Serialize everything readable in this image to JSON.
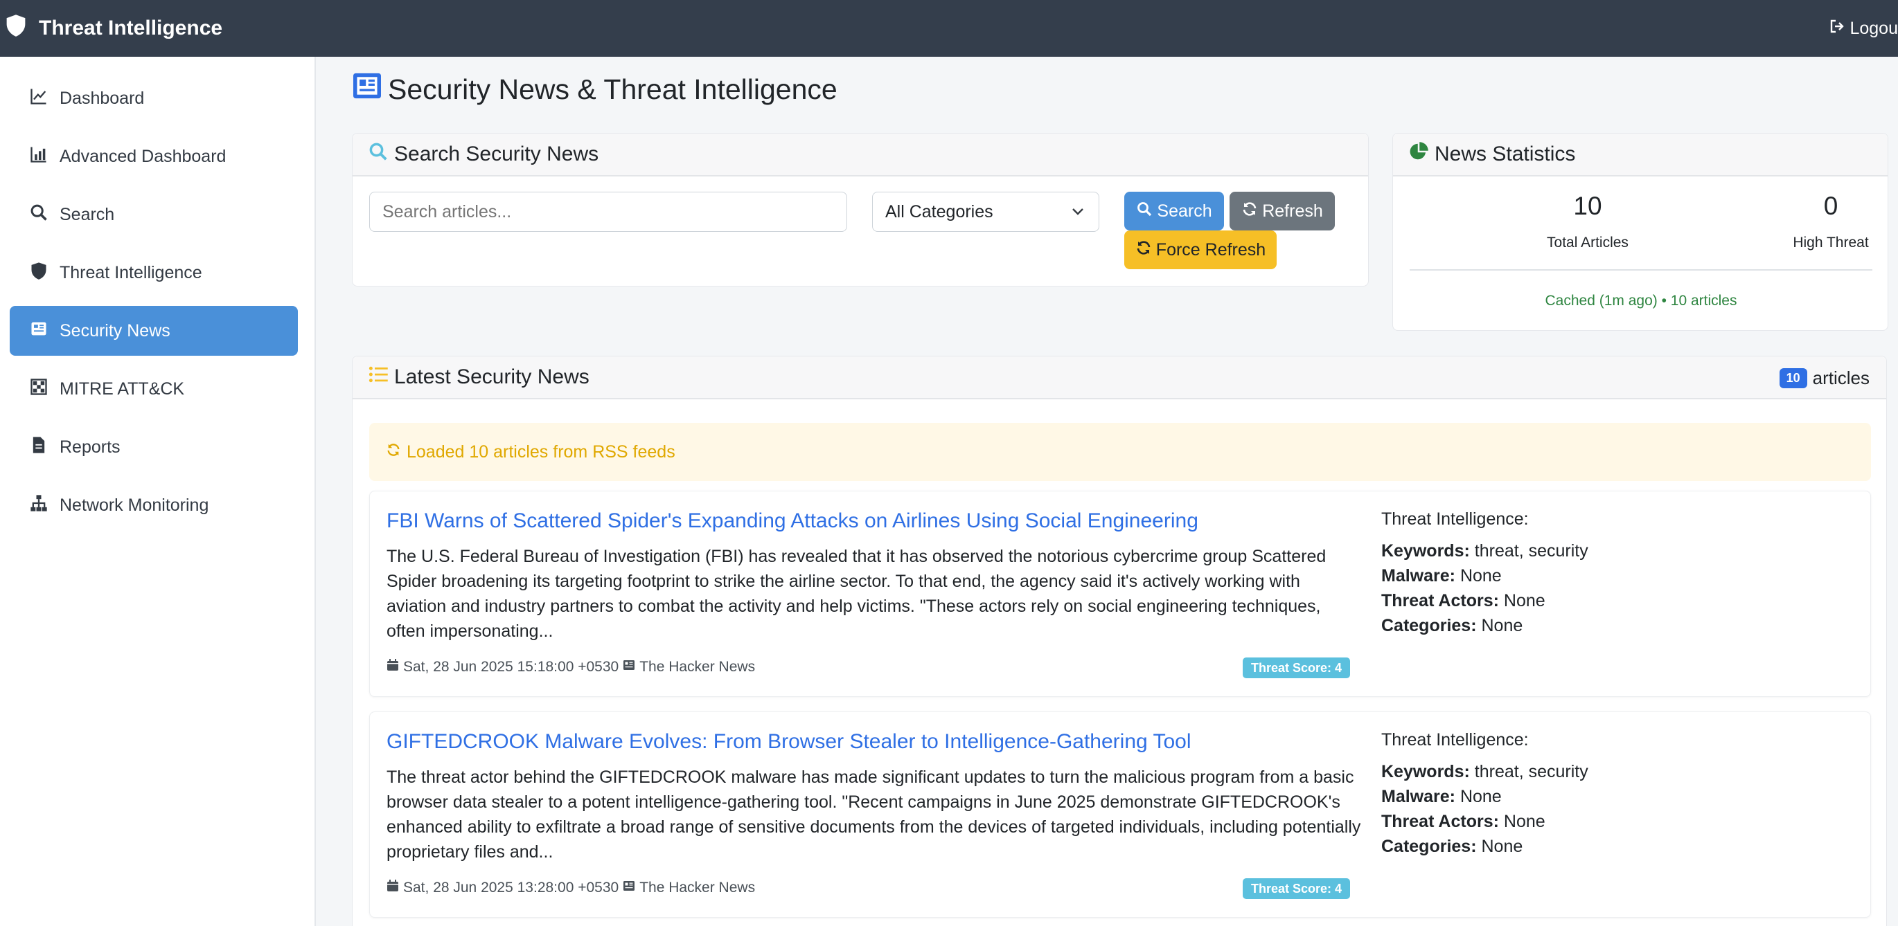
{
  "app": {
    "title": "Threat Intelligence",
    "logout_label": "Logou"
  },
  "sidebar": {
    "items": [
      {
        "label": "Dashboard",
        "icon": "chart-line-icon"
      },
      {
        "label": "Advanced Dashboard",
        "icon": "chart-bar-icon"
      },
      {
        "label": "Search",
        "icon": "search-icon"
      },
      {
        "label": "Threat Intelligence",
        "icon": "shield-icon"
      },
      {
        "label": "Security News",
        "icon": "newspaper-icon",
        "active": true
      },
      {
        "label": "MITRE ATT&CK",
        "icon": "chess-board-icon"
      },
      {
        "label": "Reports",
        "icon": "file-icon"
      },
      {
        "label": "Network Monitoring",
        "icon": "sitemap-icon"
      }
    ]
  },
  "page": {
    "title": "Security News & Threat Intelligence"
  },
  "search_card": {
    "title": "Search Security News",
    "placeholder": "Search articles...",
    "category_selected": "All Categories",
    "search_label": "Search",
    "refresh_label": "Refresh",
    "force_refresh_label": "Force Refresh"
  },
  "stats": {
    "title": "News Statistics",
    "total_value": "10",
    "total_label": "Total Articles",
    "high_value": "0",
    "high_label": "High Threat",
    "cache_text": "Cached (1m ago) • 10 articles"
  },
  "news": {
    "title": "Latest Security News",
    "count": "10",
    "count_label": "articles",
    "alert": "Loaded 10 articles from RSS feeds",
    "ti_heading": "Threat Intelligence:",
    "keywords_label": "Keywords:",
    "malware_label": "Malware:",
    "actors_label": "Threat Actors:",
    "categories_label": "Categories:",
    "articles": [
      {
        "title": "FBI Warns of Scattered Spider's Expanding Attacks on Airlines Using Social Engineering",
        "body": "The U.S. Federal Bureau of Investigation (FBI) has revealed that it has observed the notorious cybercrime group Scattered Spider broadening its targeting footprint to strike the airline sector. To that end, the agency said it's actively working with aviation and industry partners to combat the activity and help victims. \"These actors rely on social engineering techniques, often impersonating...",
        "date": "Sat, 28 Jun 2025 15:18:00 +0530",
        "source": "The Hacker News",
        "score": "Threat Score: 4",
        "keywords": "threat, security",
        "malware": "None",
        "actors": "None",
        "categories": "None"
      },
      {
        "title": "GIFTEDCROOK Malware Evolves: From Browser Stealer to Intelligence-Gathering Tool",
        "body": "The threat actor behind the GIFTEDCROOK malware has made significant updates to turn the malicious program from a basic browser data stealer to a potent intelligence-gathering tool. \"Recent campaigns in June 2025 demonstrate GIFTEDCROOK's enhanced ability to exfiltrate a broad range of sensitive documents from the devices of targeted individuals, including potentially proprietary files and...",
        "date": "Sat, 28 Jun 2025 13:28:00 +0530",
        "source": "The Hacker News",
        "score": "Threat Score: 4",
        "keywords": "threat, security",
        "malware": "None",
        "actors": "None",
        "categories": "None"
      }
    ]
  },
  "colors": {
    "topbar": "#343e4c",
    "accent": "#4a90d9",
    "link": "#2f6fe4",
    "warning": "#f6bf26",
    "info": "#5bc0de",
    "success": "#2e8540"
  }
}
